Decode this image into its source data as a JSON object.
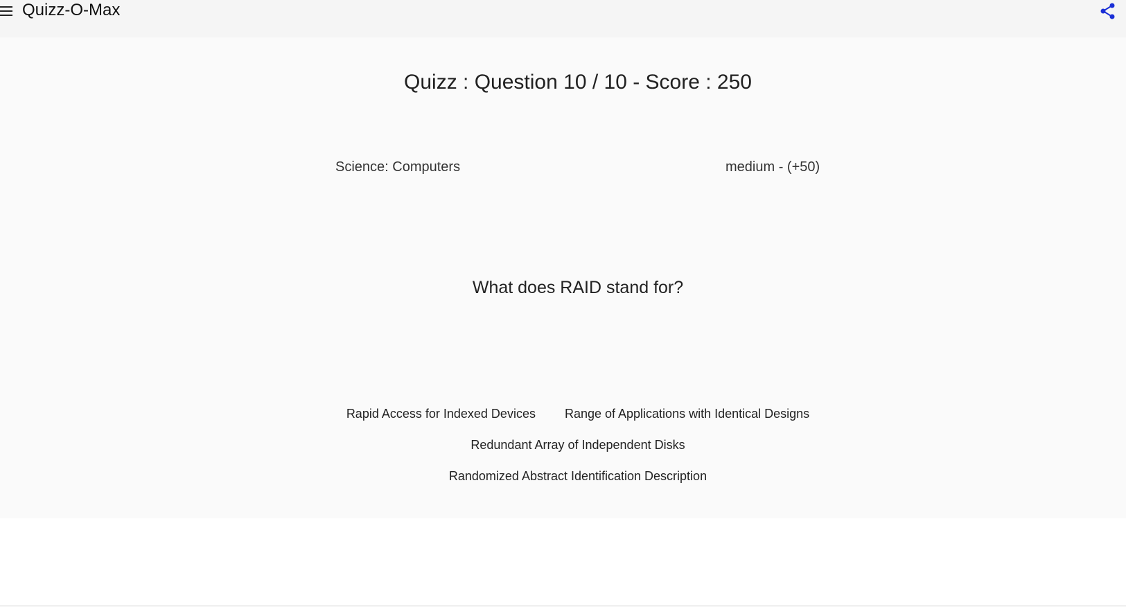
{
  "app": {
    "title": "Quizz-O-Max",
    "menu_icon": "hamburger-menu-icon",
    "share_icon": "share-icon",
    "accent_color": "#1a2fd6"
  },
  "quiz": {
    "header": "Quizz : Question 10 / 10 - Score : 250",
    "category": "Science: Computers",
    "difficulty": "medium - (+50)",
    "question": "What does RAID stand for?",
    "answers": [
      "Rapid Access for Indexed Devices",
      "Range of Applications with Identical Designs",
      "Redundant Array of Independent Disks",
      "Randomized Abstract Identification Description"
    ]
  }
}
